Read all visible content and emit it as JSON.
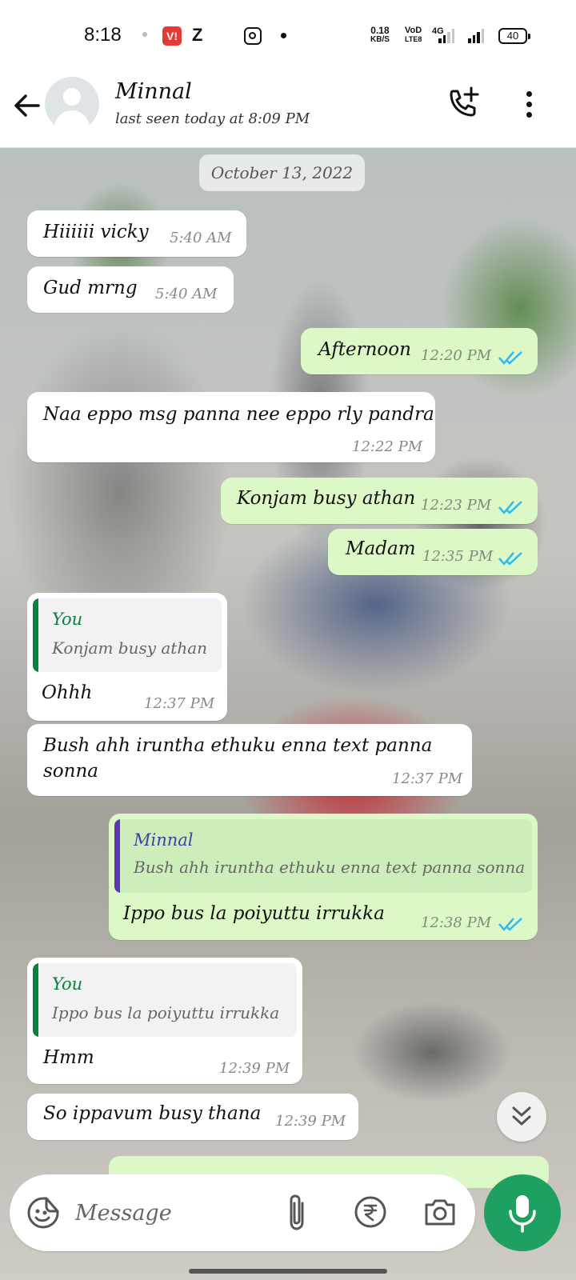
{
  "status_bar": {
    "time": "8:18",
    "carrier_badge": "V!",
    "app_badge": "Z",
    "speed_value": "0.18",
    "speed_unit": "KB/S",
    "volte_top": "VoD",
    "volte_bottom": "LTE8",
    "network": "4G",
    "battery": "40"
  },
  "header": {
    "contact_name": "Minnal",
    "last_seen": "last seen today at 8:09 PM",
    "icons": [
      "back-arrow-icon",
      "avatar-placeholder",
      "add-call-icon",
      "more-vertical-icon"
    ]
  },
  "chat": {
    "date_chip": "October 13, 2022",
    "messages": [
      {
        "dir": "in",
        "text": "Hiiiiii vicky",
        "time": "5:40 AM"
      },
      {
        "dir": "in",
        "text": "Gud mrng",
        "time": "5:40 AM"
      },
      {
        "dir": "out",
        "text": "Afternoon",
        "time": "12:20 PM",
        "status": "read"
      },
      {
        "dir": "in",
        "text": "Naa eppo msg panna nee eppo rly pandra",
        "time": "12:22 PM"
      },
      {
        "dir": "out",
        "text": "Konjam busy athan",
        "time": "12:23 PM",
        "status": "read"
      },
      {
        "dir": "out",
        "text": "Madam",
        "time": "12:35 PM",
        "status": "read"
      },
      {
        "dir": "in",
        "quote_author": "You",
        "quote_text": "Konjam busy athan",
        "text": "Ohhh",
        "time": "12:37 PM"
      },
      {
        "dir": "in",
        "text_line1": "Bush ahh iruntha ethuku enna text panna",
        "text_line2": "sonna",
        "time": "12:37 PM"
      },
      {
        "dir": "out",
        "quote_author": "Minnal",
        "quote_text": "Bush ahh iruntha ethuku enna text panna sonna",
        "text": "Ippo bus la poiyuttu irrukka",
        "time": "12:38 PM",
        "status": "read"
      },
      {
        "dir": "in",
        "quote_author": "You",
        "quote_text": "Ippo bus la poiyuttu irrukka",
        "text": "Hmm",
        "time": "12:39 PM"
      },
      {
        "dir": "in",
        "text": "So ippavum busy thana",
        "time": "12:39 PM"
      }
    ]
  },
  "composer": {
    "placeholder": "Message",
    "icons": [
      "emoji-sticker-icon",
      "attach-paperclip-icon",
      "rupee-payment-icon",
      "camera-icon",
      "mic-icon"
    ]
  },
  "colors": {
    "incoming_bubble": "#ffffff",
    "outgoing_bubble": "#dcf8c6",
    "read_tick": "#34b7f1",
    "quote_you": "#0b8043",
    "quote_minnal": "#5e35b1",
    "mic_button": "#1ea160"
  }
}
